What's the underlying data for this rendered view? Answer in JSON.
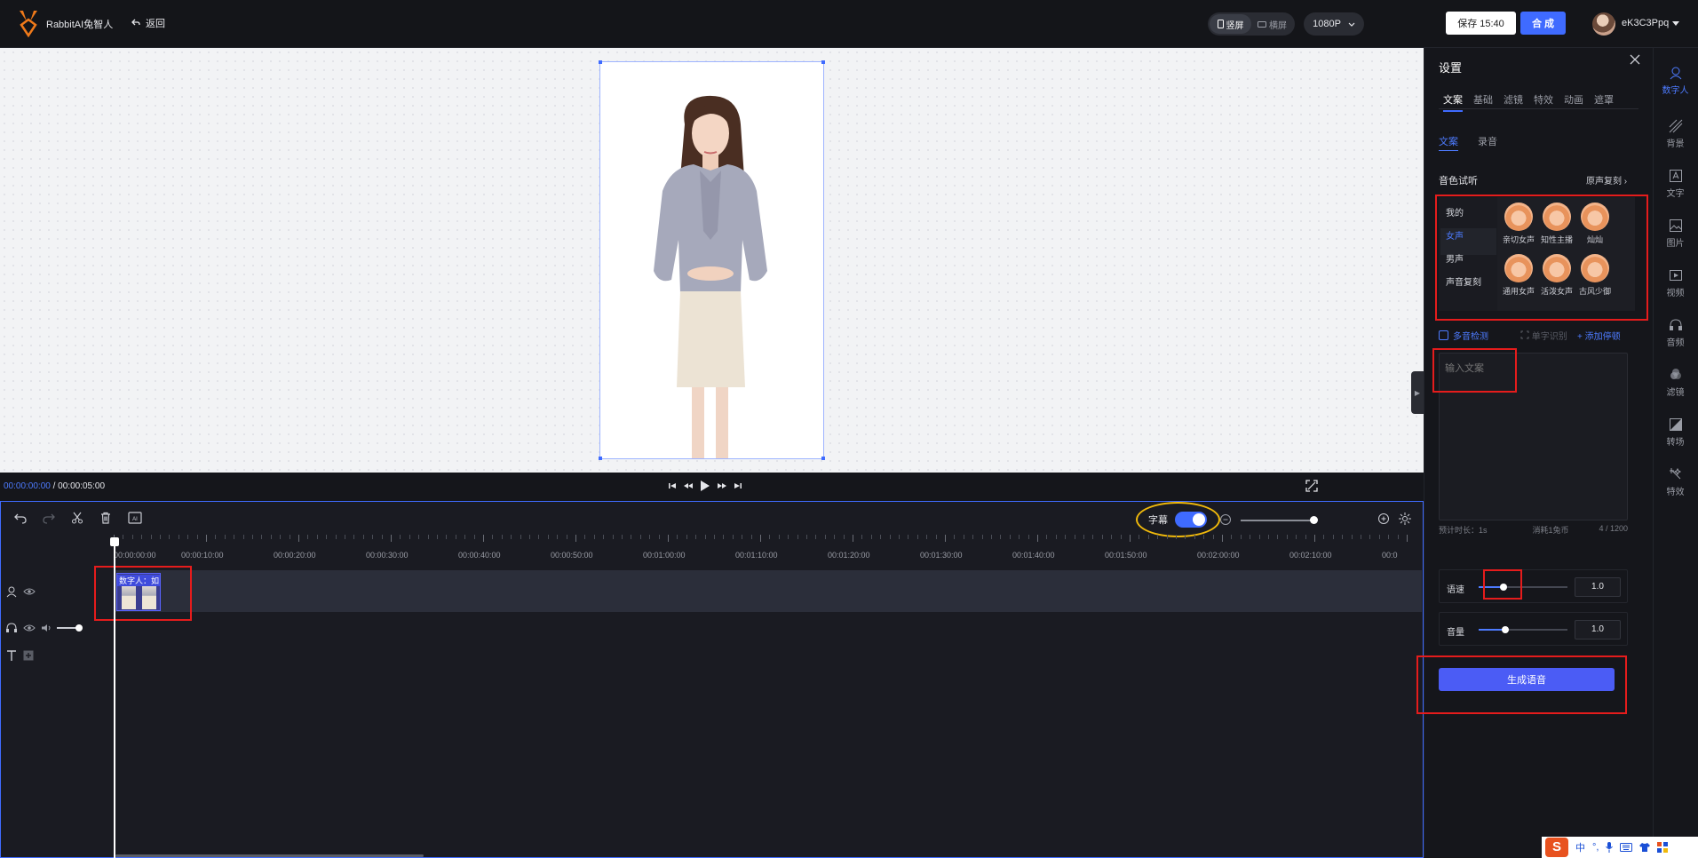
{
  "header": {
    "brand": "RabbitAI兔智人",
    "back_label": "返回",
    "orientation": {
      "portrait": "竖屏",
      "landscape": "横屏",
      "active": "portrait"
    },
    "resolution": "1080P",
    "save_label": "保存 15:40",
    "compose_label": "合 成",
    "username": "eK3C3Ppq"
  },
  "player": {
    "current_time": "00:00:00:00",
    "separator": "/",
    "total_time": "00:00:05:00"
  },
  "timeline": {
    "subtitle_label": "字幕",
    "subtitle_on": true,
    "ruler_labels": [
      "00:00:00:00",
      "00:00:10:00",
      "00:00:20:00",
      "00:00:30:00",
      "00:00:40:00",
      "00:00:50:00",
      "00:01:00:00",
      "00:01:10:00",
      "00:01:20:00",
      "00:01:30:00",
      "00:01:40:00",
      "00:01:50:00",
      "00:02:00:00",
      "00:02:10:00",
      "00:0"
    ],
    "clip_label": "数字人：如"
  },
  "settings": {
    "title": "设置",
    "tabs": [
      "文案",
      "基础",
      "滤镜",
      "特效",
      "动画",
      "遮罩"
    ],
    "active_tab": "文案",
    "subtabs": [
      "文案",
      "录音"
    ],
    "active_subtab": "文案",
    "voice_section_title": "音色试听",
    "voice_clone_link": "原声复刻",
    "voice_categories": [
      "我的",
      "女声",
      "男声",
      "声音复刻"
    ],
    "active_category": "女声",
    "voices": [
      "亲切女声",
      "知性主播",
      "灿灿",
      "通用女声",
      "活泼女声",
      "古风少御"
    ],
    "multi_detect_label": "多音检测",
    "word_recognition_label": "单字识别",
    "add_pause_label": "+ 添加停顿",
    "text_placeholder": "输入文案",
    "estimated_label": "预计时长：1s",
    "cost_label": "消耗1兔币",
    "char_count": "4 / 1200",
    "speed": {
      "label": "语速",
      "value": "1.0"
    },
    "volume": {
      "label": "音量",
      "value": "1.0"
    },
    "generate_label": "生成语音"
  },
  "sidenav": [
    {
      "label": "数字人",
      "icon": "digital-human-icon",
      "active": true
    },
    {
      "label": "背景",
      "icon": "background-icon"
    },
    {
      "label": "文字",
      "icon": "text-icon"
    },
    {
      "label": "图片",
      "icon": "image-icon"
    },
    {
      "label": "视频",
      "icon": "video-icon"
    },
    {
      "label": "音频",
      "icon": "audio-icon"
    },
    {
      "label": "滤镜",
      "icon": "filter-icon"
    },
    {
      "label": "转场",
      "icon": "transition-icon"
    },
    {
      "label": "特效",
      "icon": "effects-icon"
    }
  ],
  "ime": {
    "lang": "中"
  },
  "colors": {
    "accent": "#3f6bff",
    "annotation_red": "#e51c1c",
    "annotation_yellow": "#f0b90b",
    "bg": "#15161b"
  }
}
